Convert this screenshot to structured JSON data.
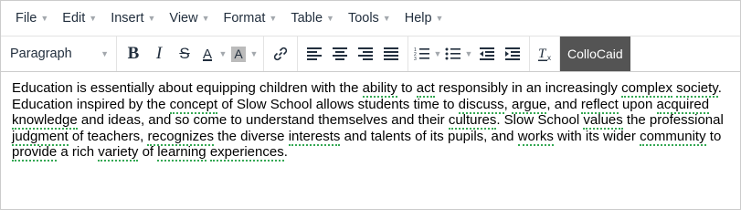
{
  "menubar": [
    {
      "label": "File"
    },
    {
      "label": "Edit"
    },
    {
      "label": "Insert"
    },
    {
      "label": "View"
    },
    {
      "label": "Format"
    },
    {
      "label": "Table"
    },
    {
      "label": "Tools"
    },
    {
      "label": "Help"
    }
  ],
  "toolbar": {
    "block_format": "Paragraph",
    "bold": "B",
    "italic": "I",
    "strikethrough": "S",
    "font_color": "A",
    "bg_color": "A",
    "collocaid": "ColloCaid"
  },
  "content": {
    "segments": [
      {
        "t": "Education is essentially about equipping children with the "
      },
      {
        "t": "ability",
        "u": true
      },
      {
        "t": " to "
      },
      {
        "t": "act",
        "u": true
      },
      {
        "t": " responsibly in an increasingly "
      },
      {
        "t": "complex",
        "u": true
      },
      {
        "t": " "
      },
      {
        "t": "society",
        "u": true
      },
      {
        "t": ". Education inspired by the "
      },
      {
        "t": "concept",
        "u": true
      },
      {
        "t": " of Slow School allows students time to "
      },
      {
        "t": "discuss",
        "u": true
      },
      {
        "t": ", "
      },
      {
        "t": "argue",
        "u": true
      },
      {
        "t": ", and "
      },
      {
        "t": "reflect",
        "u": true
      },
      {
        "t": " upon "
      },
      {
        "t": "acquired",
        "u": true
      },
      {
        "t": " "
      },
      {
        "t": "knowledge",
        "u": true
      },
      {
        "t": "  and ideas, and so come to understand themselves and their "
      },
      {
        "t": "cultures",
        "u": true
      },
      {
        "t": ". Slow School "
      },
      {
        "t": "values",
        "u": true
      },
      {
        "t": " the professional "
      },
      {
        "t": "judgment",
        "u": true
      },
      {
        "t": " of teachers, "
      },
      {
        "t": "recognizes",
        "u": true
      },
      {
        "t": " the diverse "
      },
      {
        "t": "interests",
        "u": true
      },
      {
        "t": " and talents of its pupils, and "
      },
      {
        "t": "works",
        "u": true
      },
      {
        "t": " with its wider "
      },
      {
        "t": "community",
        "u": true
      },
      {
        "t": " to "
      },
      {
        "t": "provide",
        "u": true
      },
      {
        "t": " a rich "
      },
      {
        "t": "variety",
        "u": true
      },
      {
        "t": " of "
      },
      {
        "t": "learning",
        "u": true
      },
      {
        "t": " "
      },
      {
        "t": "experiences",
        "u": true
      },
      {
        "t": "."
      }
    ]
  },
  "colors": {
    "underline": "#34a853",
    "collocaid_bg": "#545454",
    "text": "#222f3e"
  }
}
